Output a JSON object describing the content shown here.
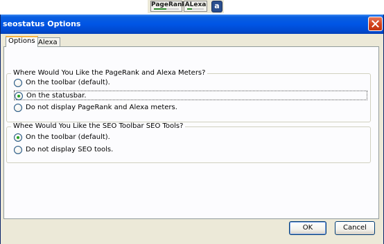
{
  "statusbar": {
    "pagerank_label": "PageRank",
    "alexa_label": "ALexa",
    "pagerank_level": 0.5,
    "alexa_level": 0.3,
    "logo_letter": "a",
    "meter_fill_color": "#2c8a2c"
  },
  "window": {
    "title": "seostatus Options",
    "close_icon": "close-icon"
  },
  "tabs": [
    {
      "label": "Options",
      "active": true
    },
    {
      "label": "Alexa",
      "active": false
    }
  ],
  "group_meters": {
    "legend": "Where Would You Like the PageRank and Alexa Meters?",
    "options": [
      {
        "label": "On the toolbar (default).",
        "checked": false
      },
      {
        "label": "On the statusbar.",
        "checked": true
      },
      {
        "label": "Do not display PageRank and Alexa meters.",
        "checked": false
      }
    ]
  },
  "group_seo_tools": {
    "legend": "Whee Would You Like the SEO Toolbar SEO Tools?",
    "options": [
      {
        "label": "On the toolbar (default).",
        "checked": true
      },
      {
        "label": "Do not display SEO tools.",
        "checked": false
      }
    ]
  },
  "buttons": {
    "ok": "OK",
    "cancel": "Cancel"
  },
  "colors": {
    "titlebar": "#0055e5",
    "radio_checked": "#21a121",
    "close_button": "#d1411b"
  }
}
